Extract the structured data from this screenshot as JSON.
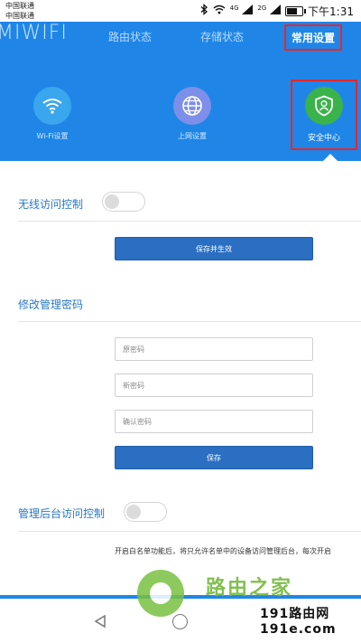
{
  "status_bar": {
    "carrier_1": "中国联通",
    "carrier_2": "中国联通",
    "signal_1_label": "4G",
    "signal_2_label": "2G",
    "time": "下午1:31",
    "battery_level": 0.7,
    "icons": [
      "bluetooth-icon",
      "wifi-icon",
      "signal-icon",
      "battery-icon"
    ]
  },
  "header": {
    "logo": "MIWIFI",
    "nav": [
      "路由状态",
      "存储状态",
      "常用设置"
    ],
    "active_nav": "常用设置",
    "tiles": [
      {
        "label": "Wi-Fi设置",
        "icon": "wifi-icon"
      },
      {
        "label": "上网设置",
        "icon": "globe-icon"
      },
      {
        "label": "安全中心",
        "icon": "shield-user-icon"
      }
    ],
    "active_tile": "安全中心",
    "colors": {
      "bar": "#1f86e8",
      "highlight_border": "#e8262a",
      "security_green": "#3ab34a"
    }
  },
  "wireless_access": {
    "title": "无线访问控制",
    "enabled": false,
    "save_button": "保存并生效"
  },
  "change_password": {
    "title": "修改管理密码",
    "old_password_placeholder": "原密码",
    "new_password_placeholder": "新密码",
    "confirm_password_placeholder": "确认密码",
    "save_button": "保存"
  },
  "admin_access": {
    "title": "管理后台访问控制",
    "enabled": false,
    "note": "开启白名单功能后，将只允许名单中的设备访问管理后台，每次开启"
  },
  "watermark": {
    "text": "路由之家",
    "brand_line_1": "191路由网",
    "brand_line_2": "191e.com"
  }
}
